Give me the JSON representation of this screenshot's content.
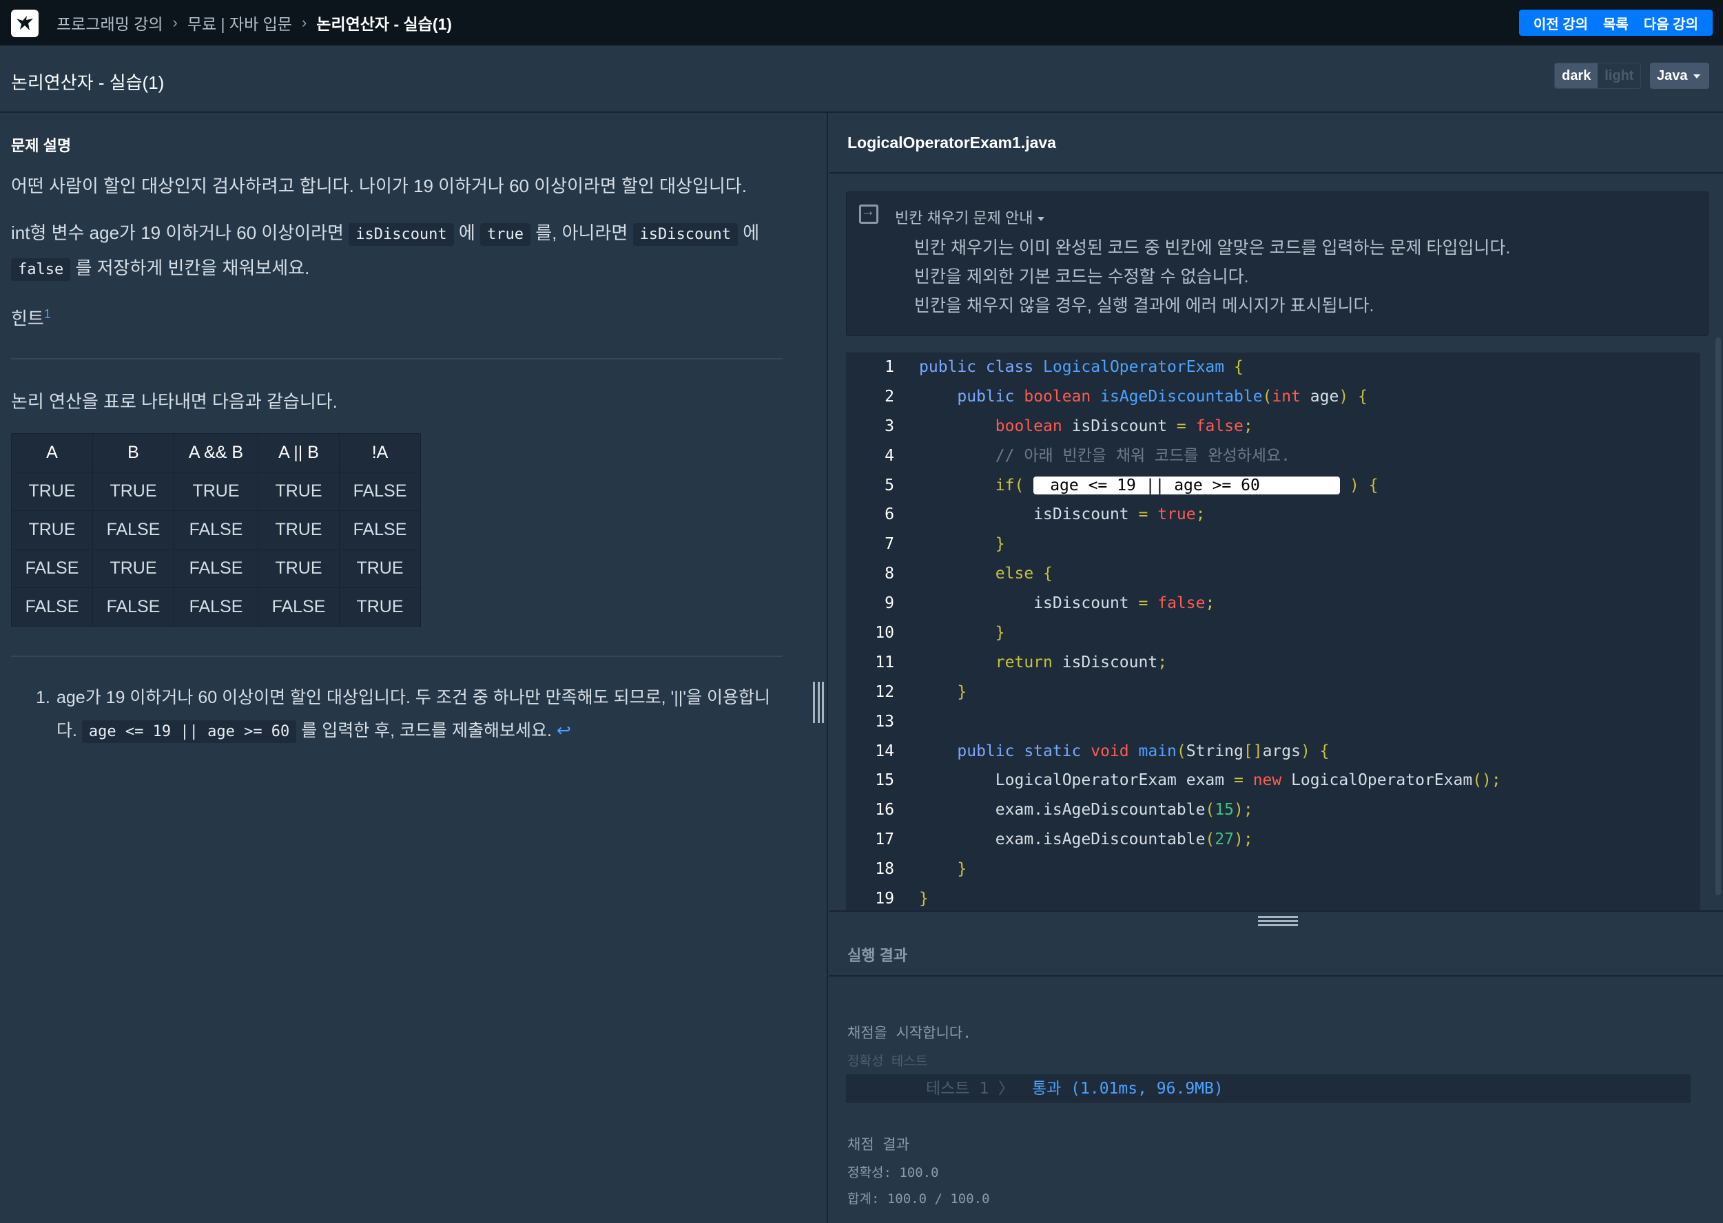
{
  "nav": {
    "breadcrumb": [
      "프로그래밍 강의",
      "무료 | 자바 입문",
      "논리연산자 - 실습(1)"
    ],
    "buttons": [
      "이전 강의",
      "목록",
      "다음 강의"
    ]
  },
  "header": {
    "title": "논리연산자 - 실습(1)",
    "theme_dark": "dark",
    "theme_light": "light",
    "language": "Java"
  },
  "problem": {
    "heading": "문제 설명",
    "p1": "어떤 사람이 할인 대상인지 검사하려고 합니다. 나이가 19 이하거나 60 이상이라면 할인 대상입니다.",
    "p2_a": "int형 변수 age가 19 이하거나 60 이상이라면 ",
    "p2_code1": "isDiscount",
    "p2_b": " 에 ",
    "p2_code2": "true",
    "p2_c": " 를, 아니라면 ",
    "p2_code3": "isDiscount",
    "p2_d": " 에",
    "p2_code4": "false",
    "p2_e": " 를 저장하게 빈칸을 채워보세요.",
    "hint": "힌트",
    "hint_sup": "1",
    "table_intro": "논리 연산을 표로 나타내면 다음과 같습니다.",
    "table": {
      "headers": [
        "A",
        "B",
        "A && B",
        "A || B",
        "!A"
      ],
      "rows": [
        [
          "TRUE",
          "TRUE",
          "TRUE",
          "TRUE",
          "FALSE"
        ],
        [
          "TRUE",
          "FALSE",
          "FALSE",
          "TRUE",
          "FALSE"
        ],
        [
          "FALSE",
          "TRUE",
          "FALSE",
          "TRUE",
          "TRUE"
        ],
        [
          "FALSE",
          "FALSE",
          "FALSE",
          "FALSE",
          "TRUE"
        ]
      ]
    },
    "footnote": {
      "num": "1.",
      "text_a": "age가 19 이하거나 60 이상이면 할인 대상입니다. 두 조건 중 하나만 만족해도 되므로, '||'을 이용합니다. ",
      "code": "age <= 19 || age >= 60",
      "text_b": " 를 입력한 후, 코드를 제출해보세요. ",
      "back": "↩"
    }
  },
  "editor": {
    "file_name": "LogicalOperatorExam1.java",
    "guide_title": "빈칸 채우기 문제 안내",
    "guide_lines": [
      "빈칸 채우기는 이미 완성된 코드 중 빈칸에 알맞은 코드를 입력하는 문제 타입입니다.",
      "빈칸을 제외한 기본 코드는 수정할 수 없습니다.",
      "빈칸을 채우지 않을 경우, 실행 결과에 에러 메시지가 표시됩니다."
    ],
    "line_numbers": [
      "1",
      "2",
      "3",
      "4",
      "5",
      "6",
      "7",
      "8",
      "9",
      "10",
      "11",
      "12",
      "13",
      "14",
      "15",
      "16",
      "17",
      "18",
      "19"
    ],
    "blank_value": "age <= 19 || age >= 60",
    "comment": "// 아래 빈칸을 채워 코드를 완성하세요."
  },
  "result": {
    "title": "실행 결과",
    "start": "채점을 시작합니다.",
    "columns": "정확성  테스트",
    "test_name": "테스트 1 〉",
    "test_result": "통과 (1.01ms, 96.9MB)",
    "summary_title": "채점 결과",
    "accuracy": "정확성: 100.0",
    "total": "합계: 100.0 / 100.0"
  },
  "icons": {
    "logo": "bird-logo-icon",
    "guide": "guide-toggle-icon"
  },
  "colors": {
    "background": "#263747",
    "topbar": "#0c151c",
    "accent": "#0078ff",
    "keyword": "#78a9ff",
    "type_keyword": "#ff5b50",
    "pass": "#4ea2ff"
  }
}
